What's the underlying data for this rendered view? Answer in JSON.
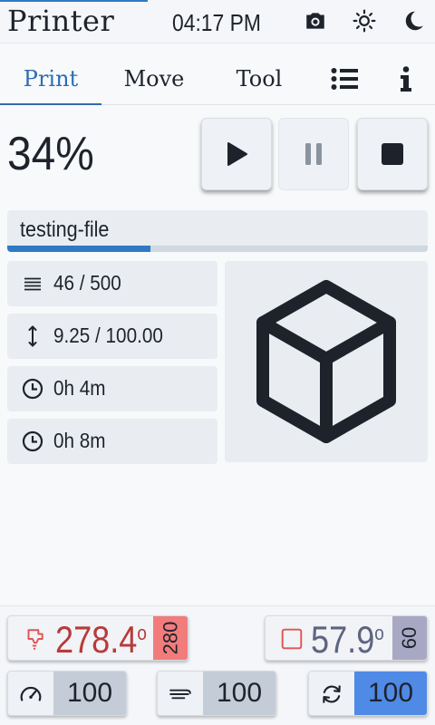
{
  "header": {
    "title": "Printer",
    "time": "04:17 PM",
    "icons": [
      "camera-icon",
      "sun-icon",
      "moon-icon"
    ]
  },
  "tabs": [
    {
      "label": "Print",
      "active": true
    },
    {
      "label": "Move",
      "active": false
    },
    {
      "label": "Tool",
      "active": false
    },
    {
      "icon": "list-icon"
    },
    {
      "icon": "info-icon"
    }
  ],
  "job": {
    "percent_label": "34%",
    "progress": 0.34,
    "file_name": "testing-file",
    "controls": [
      "play-icon",
      "pause-icon",
      "stop-icon"
    ]
  },
  "stats": {
    "layers": "46 / 500",
    "height": "9.25 / 100.00",
    "elapsed": "0h 4m",
    "remaining": "0h 8m"
  },
  "temps": {
    "hotend": {
      "value": "278.4",
      "unit": "o",
      "target": "280",
      "color": "#b83a3a",
      "target_bg": "#f27c7c"
    },
    "bed": {
      "value": "57.9",
      "unit": "o",
      "target": "60",
      "color": "#5e6480",
      "target_bg": "#a9a8c4"
    }
  },
  "factors": {
    "speed": {
      "value": "100",
      "bg": "#c3ccd7"
    },
    "flow": {
      "value": "100",
      "bg": "#c3ccd7"
    },
    "fan": {
      "value": "100",
      "bg": "#4f8ae6"
    }
  },
  "colors": {
    "accent": "#2f6db0",
    "progress": "#2f7ac4"
  }
}
